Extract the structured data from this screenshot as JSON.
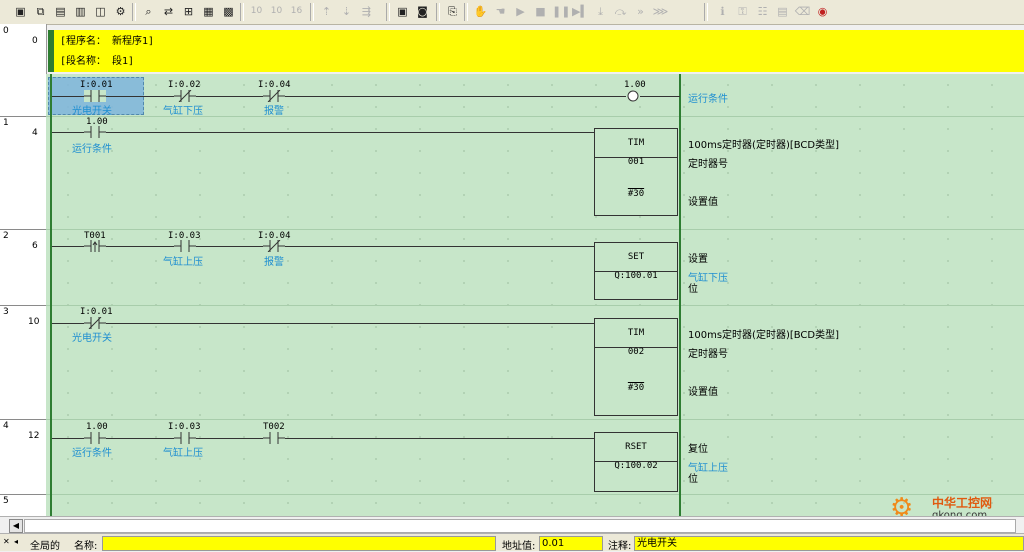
{
  "toolbar": {
    "icons": [
      "new-icon",
      "open-icon",
      "save-icon",
      "print-icon",
      "window-icon",
      "config-icon",
      "find-icon",
      "replace-icon",
      "cross-ref-icon",
      "io-table-icon",
      "memory-icon",
      "w10-icon",
      "w10b-icon",
      "w16-icon",
      "up-icon",
      "down-icon",
      "split-icon",
      "monitor-icon",
      "online-icon",
      "compare-icon",
      "hand-icon",
      "hand2-icon",
      "run-icon",
      "stop-icon",
      "pause-icon",
      "step-icon",
      "step-in-icon",
      "step-over-icon",
      "step-out-icon",
      "address-icon",
      "comment-icon",
      "table-icon",
      "list-icon",
      "clear-icon",
      "eraser-icon"
    ],
    "w10_label": "10",
    "w10b_label": "10",
    "w16_label": "16"
  },
  "header": {
    "program_name": "[程序名： 新程序1]",
    "section_name": "[段名称： 段1]"
  },
  "rungs": [
    {
      "rung": "0",
      "step": "0"
    },
    {
      "rung": "1",
      "step": "4"
    },
    {
      "rung": "2",
      "step": "6"
    },
    {
      "rung": "3",
      "step": "10"
    },
    {
      "rung": "4",
      "step": "12"
    },
    {
      "rung": "5",
      "step": ""
    }
  ],
  "rung1": {
    "c1_addr": "I:0.01",
    "c1_cmt": "光电开关",
    "c2_addr": "I:0.02",
    "c2_cmt": "气缸下压",
    "c3_addr": "I:0.04",
    "c3_cmt": "报警",
    "coil_addr": "1.00",
    "coil_cmt": "运行条件"
  },
  "rung2": {
    "c1_addr": "1.00",
    "c1_cmt": "运行条件",
    "fb_name": "TIM",
    "fb_op1": "001",
    "fb_op2": "#30",
    "r_title": "100ms定时器(定时器)[BCD类型]",
    "r_op1": "定时器号",
    "r_op2": "设置值"
  },
  "rung3": {
    "c1_addr": "T001",
    "c2_addr": "I:0.03",
    "c2_cmt": "气缸上压",
    "c3_addr": "I:0.04",
    "c3_cmt": "报警",
    "fb_name": "SET",
    "fb_op1": "Q:100.01",
    "r_title": "设置",
    "r_cmt": "气缸下压",
    "r_op": "位"
  },
  "rung4": {
    "c1_addr": "I:0.01",
    "c1_cmt": "光电开关",
    "fb_name": "TIM",
    "fb_op1": "002",
    "fb_op2": "#30",
    "r_title": "100ms定时器(定时器)[BCD类型]",
    "r_op1": "定时器号",
    "r_op2": "设置值"
  },
  "rung5": {
    "c1_addr": "1.00",
    "c1_cmt": "运行条件",
    "c2_addr": "I:0.03",
    "c2_cmt": "气缸上压",
    "c3_addr": "T002",
    "fb_name": "RSET",
    "fb_op1": "Q:100.02",
    "r_title": "复位",
    "r_cmt": "气缸上压",
    "r_op": "位"
  },
  "status": {
    "scope": "全局的",
    "name_label": "名称:",
    "name_value": "",
    "address_label": "地址值:",
    "address_value": "0.01",
    "comment_label": "注释:",
    "comment_value": "光电开关"
  },
  "watermark": {
    "cn": "中华工控网",
    "en": "gkong.com"
  },
  "colors": {
    "ladder_bg": "#c7e6c9",
    "header_bg": "#ffff00",
    "comment": "#1f8fd1",
    "rail": "#2e7d32"
  }
}
